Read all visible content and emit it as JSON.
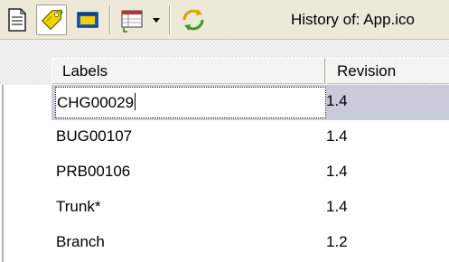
{
  "toolbar": {
    "title": "History of: App.ico",
    "buttons": [
      {
        "icon": "document-icon"
      },
      {
        "icon": "label-tag-icon",
        "pressed": true
      },
      {
        "icon": "window-icon"
      },
      {
        "icon": "list-columns-icon"
      },
      {
        "icon": "dropdown-arrow-icon"
      },
      {
        "icon": "refresh-icon"
      }
    ]
  },
  "table": {
    "columns": [
      "Labels",
      "Revision"
    ],
    "rows": [
      {
        "label": "CHG00029",
        "revision": "1.4",
        "selected": true,
        "editing": true
      },
      {
        "label": "BUG00107",
        "revision": "1.4"
      },
      {
        "label": "PRB00106",
        "revision": "1.4"
      },
      {
        "label": "Trunk*",
        "revision": "1.4"
      },
      {
        "label": "Branch",
        "revision": "1.2"
      }
    ]
  },
  "colors": {
    "toolbar_bg": "#ece9d8",
    "selection": "#c9cbdb",
    "header_bg": "#f4f4f1"
  }
}
